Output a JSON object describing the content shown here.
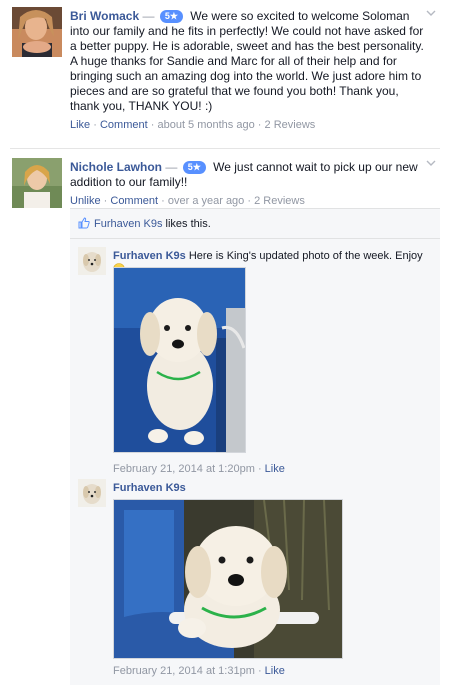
{
  "review1": {
    "author": "Bri Womack",
    "dash": "—",
    "rating": "5★",
    "text": "We were so excited to welcome Soloman into our family and he fits in perfectly! We could not have asked for a better puppy. He is adorable, sweet and has the best personality. A huge thanks for Sandie and Marc for all of their help and for bringing such an amazing dog into the world. We just adore him to pieces and are so grateful that we found you both! Thank you, thank you, THANK YOU! :)",
    "like": "Like",
    "comment": "Comment",
    "time": "about 5 months ago",
    "reviews": "2 Reviews",
    "sep": "·"
  },
  "review2": {
    "author": "Nichole Lawhon",
    "dash": "—",
    "rating": "5★",
    "text": "We just cannot wait to pick up our new addition to our family!!",
    "unlike": "Unlike",
    "comment": "Comment",
    "time": "over a year ago",
    "reviews": "2 Reviews",
    "sep": "·"
  },
  "likes": {
    "name": "Furhaven K9s",
    "rest": "likes this."
  },
  "comments": [
    {
      "author": "Furhaven K9s",
      "text": "Here is King's updated photo of the week. Enjoy",
      "date": "February 21, 2014 at 1:20pm",
      "sep": "·",
      "like": "Like"
    },
    {
      "author": "Furhaven K9s",
      "date": "February 21, 2014 at 1:31pm",
      "sep": "·",
      "like": "Like"
    }
  ],
  "icons": {
    "badge_color": "#5890ff",
    "link_color": "#3b5998",
    "meta_color": "#9197a3",
    "chevron": "chevron-down-icon",
    "thumb": "thumbs-up-icon",
    "smile": "smiley-icon"
  }
}
